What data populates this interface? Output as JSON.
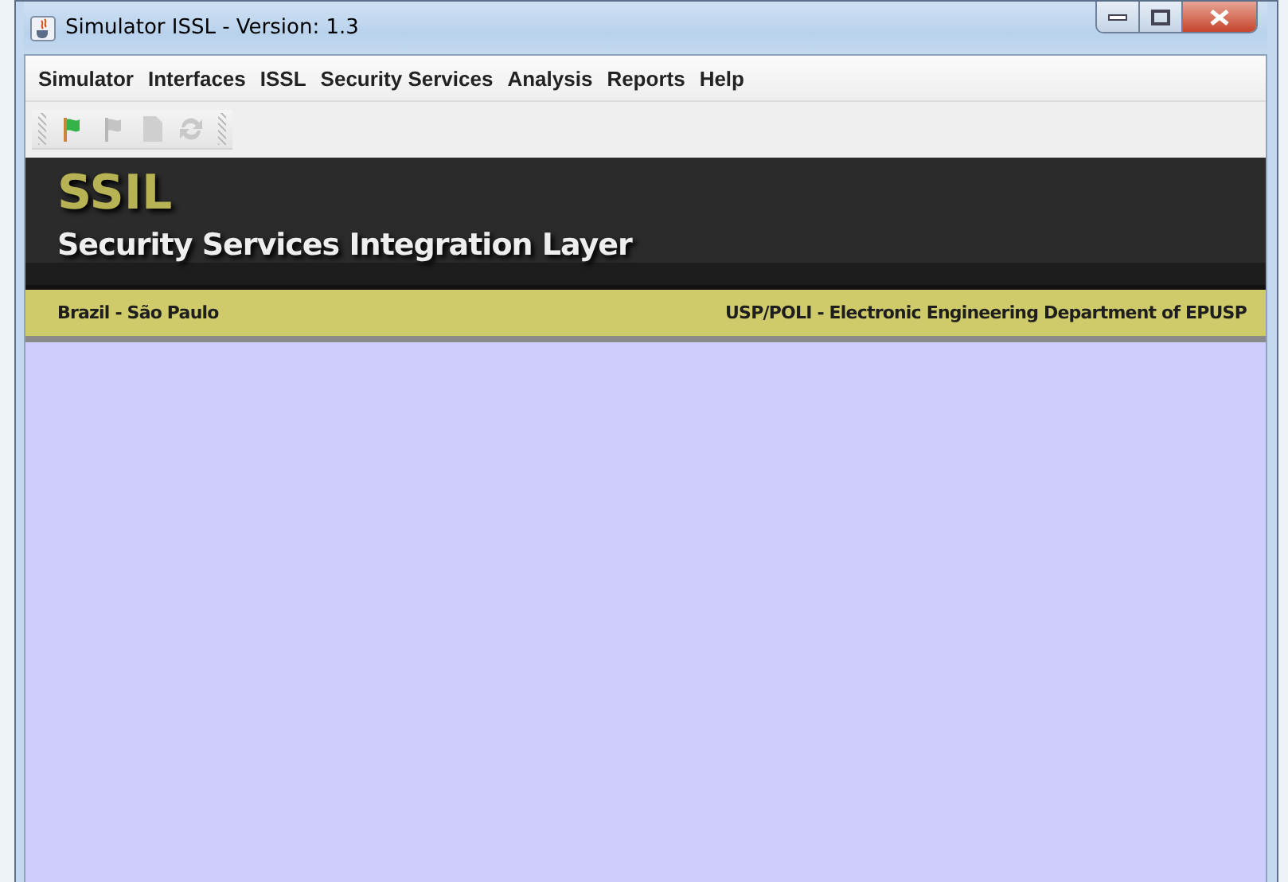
{
  "window": {
    "title": "Simulator ISSL - Version: 1.3"
  },
  "menu": [
    "Simulator",
    "Interfaces",
    "ISSL",
    "Security Services",
    "Analysis",
    "Reports",
    "Help"
  ],
  "toolbar": [
    {
      "kind": "flag",
      "disabled": false
    },
    {
      "kind": "flag",
      "disabled": true
    },
    {
      "kind": "document",
      "disabled": true
    },
    {
      "kind": "refresh",
      "disabled": true
    }
  ],
  "banner": {
    "logo": "SSIL",
    "subtitle": "Security Services Integration Layer"
  },
  "status_strip": {
    "left": "Brazil - São Paulo",
    "right": "USP/POLI - Electronic Engineering Department of EPUSP"
  }
}
